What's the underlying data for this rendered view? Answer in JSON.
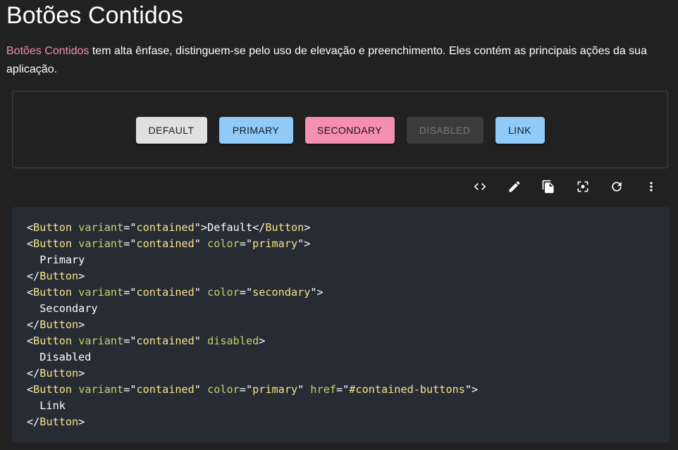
{
  "page": {
    "title": "Botões Contidos",
    "desc_link": "Botões Contidos",
    "desc_rest": " tem alta ênfase, distinguem-se pelo uso de elevação e preenchimento. Eles contém as principais ações da sua aplicação."
  },
  "demo": {
    "buttons": {
      "default": "DEFAULT",
      "primary": "PRIMARY",
      "secondary": "SECONDARY",
      "disabled": "DISABLED",
      "link": "LINK"
    }
  },
  "toolbar": {
    "icons": [
      "code-icon",
      "edit-icon",
      "copy-icon",
      "screenshot-icon",
      "refresh-icon",
      "more-icon"
    ]
  },
  "code": {
    "lines": [
      [
        [
          "t",
          "<"
        ],
        [
          "tg",
          "Button"
        ],
        [
          "t",
          " "
        ],
        [
          "at",
          "variant"
        ],
        [
          "t",
          "=\""
        ],
        [
          "st",
          "contained"
        ],
        [
          "t",
          "\">Default</"
        ],
        [
          "tg",
          "Button"
        ],
        [
          "t",
          ">"
        ]
      ],
      [
        [
          "t",
          "<"
        ],
        [
          "tg",
          "Button"
        ],
        [
          "t",
          " "
        ],
        [
          "at",
          "variant"
        ],
        [
          "t",
          "=\""
        ],
        [
          "st",
          "contained"
        ],
        [
          "t",
          "\" "
        ],
        [
          "at",
          "color"
        ],
        [
          "t",
          "=\""
        ],
        [
          "st",
          "primary"
        ],
        [
          "t",
          "\">"
        ]
      ],
      [
        [
          "t",
          "  Primary"
        ]
      ],
      [
        [
          "t",
          "</"
        ],
        [
          "tg",
          "Button"
        ],
        [
          "t",
          ">"
        ]
      ],
      [
        [
          "t",
          "<"
        ],
        [
          "tg",
          "Button"
        ],
        [
          "t",
          " "
        ],
        [
          "at",
          "variant"
        ],
        [
          "t",
          "=\""
        ],
        [
          "st",
          "contained"
        ],
        [
          "t",
          "\" "
        ],
        [
          "at",
          "color"
        ],
        [
          "t",
          "=\""
        ],
        [
          "st",
          "secondary"
        ],
        [
          "t",
          "\">"
        ]
      ],
      [
        [
          "t",
          "  Secondary"
        ]
      ],
      [
        [
          "t",
          "</"
        ],
        [
          "tg",
          "Button"
        ],
        [
          "t",
          ">"
        ]
      ],
      [
        [
          "t",
          "<"
        ],
        [
          "tg",
          "Button"
        ],
        [
          "t",
          " "
        ],
        [
          "at",
          "variant"
        ],
        [
          "t",
          "=\""
        ],
        [
          "st",
          "contained"
        ],
        [
          "t",
          "\" "
        ],
        [
          "at",
          "disabled"
        ],
        [
          "t",
          ">"
        ]
      ],
      [
        [
          "t",
          "  Disabled"
        ]
      ],
      [
        [
          "t",
          "</"
        ],
        [
          "tg",
          "Button"
        ],
        [
          "t",
          ">"
        ]
      ],
      [
        [
          "t",
          "<"
        ],
        [
          "tg",
          "Button"
        ],
        [
          "t",
          " "
        ],
        [
          "at",
          "variant"
        ],
        [
          "t",
          "=\""
        ],
        [
          "st",
          "contained"
        ],
        [
          "t",
          "\" "
        ],
        [
          "at",
          "color"
        ],
        [
          "t",
          "=\""
        ],
        [
          "st",
          "primary"
        ],
        [
          "t",
          "\" "
        ],
        [
          "at",
          "href"
        ],
        [
          "t",
          "=\""
        ],
        [
          "st",
          "#contained-buttons"
        ],
        [
          "t",
          "\">"
        ]
      ],
      [
        [
          "t",
          "  Link"
        ]
      ],
      [
        [
          "t",
          "</"
        ],
        [
          "tg",
          "Button"
        ],
        [
          "t",
          ">"
        ]
      ]
    ]
  }
}
